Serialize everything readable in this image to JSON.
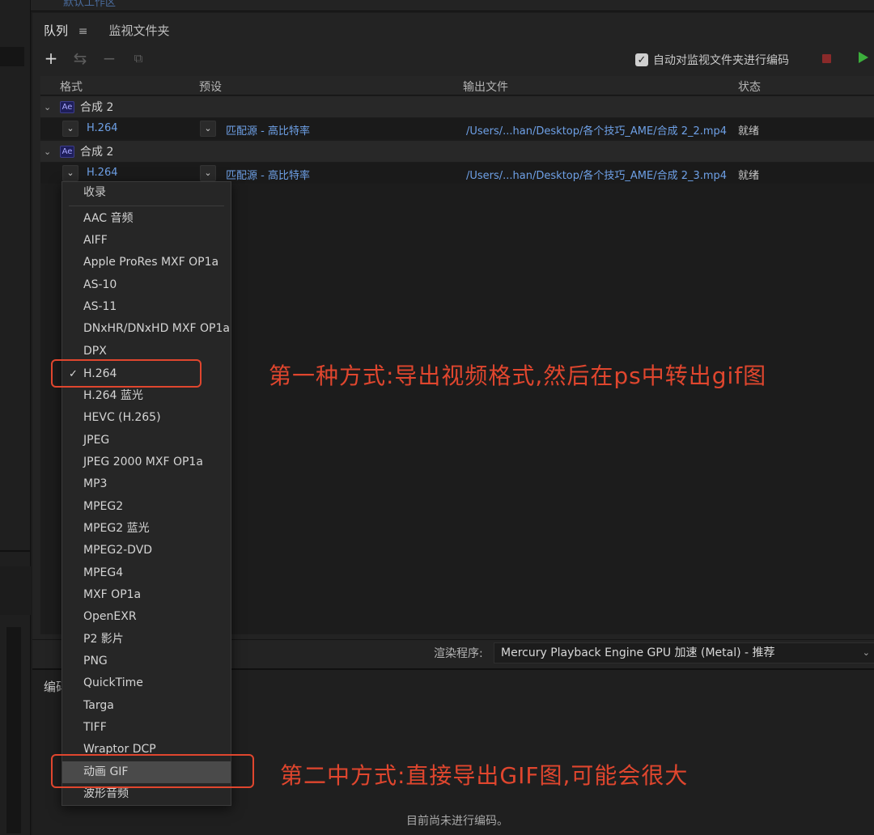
{
  "top_remnant": "默认工作区",
  "tabs": {
    "queue": "队列",
    "watch": "监视文件夹"
  },
  "icons": {
    "queue_menu": "≡",
    "add": "+",
    "settings": "⇆",
    "remove": "−",
    "duplicate": "⧉",
    "chevron": "⌄",
    "check": "✓",
    "checkbox": "✓"
  },
  "auto_encode_label": "自动对监视文件夹进行编码",
  "columns": {
    "format": "格式",
    "preset": "预设",
    "output": "输出文件",
    "status": "状态"
  },
  "groups": [
    {
      "badge": "Ae",
      "name": "合成 2",
      "format": "H.264",
      "preset": "匹配源 - 高比特率",
      "output": "/Users/...han/Desktop/各个技巧_AME/合成 2_2.mp4",
      "status": "就绪"
    },
    {
      "badge": "Ae",
      "name": "合成 2",
      "format": "H.264",
      "preset": "匹配源 - 高比特率",
      "output": "/Users/...han/Desktop/各个技巧_AME/合成 2_3.mp4",
      "status": "就绪"
    }
  ],
  "renderer": {
    "label": "渲染程序:",
    "value": "Mercury Playback Engine GPU 加速 (Metal) - 推荐"
  },
  "encoding": {
    "title": "编码",
    "status": "目前尚未进行编码。"
  },
  "format_menu": {
    "header": "收录",
    "items": [
      "AAC 音频",
      "AIFF",
      "Apple ProRes MXF OP1a",
      "AS-10",
      "AS-11",
      "DNxHR/DNxHD MXF OP1a",
      "DPX",
      "H.264",
      "H.264 蓝光",
      "HEVC (H.265)",
      "JPEG",
      "JPEG 2000 MXF OP1a",
      "MP3",
      "MPEG2",
      "MPEG2 蓝光",
      "MPEG2-DVD",
      "MPEG4",
      "MXF OP1a",
      "OpenEXR",
      "P2 影片",
      "PNG",
      "QuickTime",
      "Targa",
      "TIFF",
      "Wraptor DCP",
      "动画 GIF",
      "波形音频"
    ],
    "selected": "H.264",
    "highlighted": "动画 GIF"
  },
  "annotations": {
    "first": "第一种方式:导出视频格式,然后在ps中转出gif图",
    "second": "第二中方式:直接导出GIF图,可能会很大"
  },
  "colors": {
    "annotation": "#e0462e",
    "link": "#6ea0e6",
    "play": "#3cae3c",
    "stop": "#8a2a2a"
  }
}
